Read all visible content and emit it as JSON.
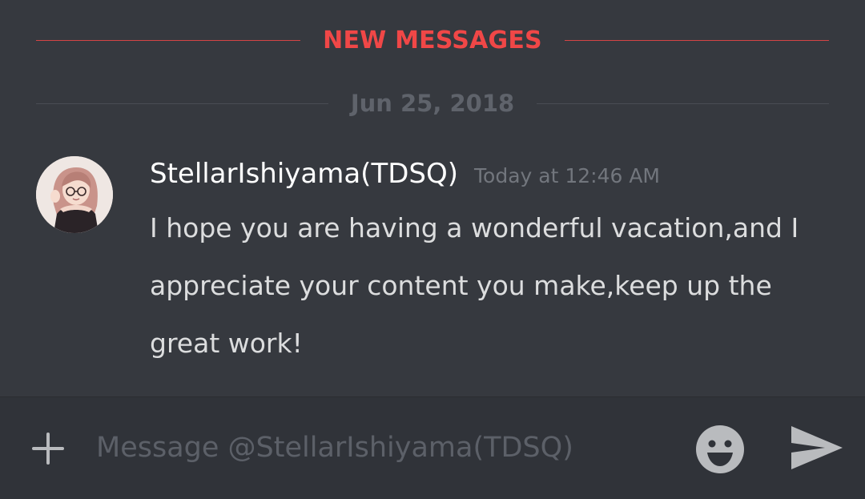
{
  "dividers": {
    "new_messages": "NEW MESSAGES",
    "date": "Jun 25, 2018"
  },
  "message": {
    "username": "StellarIshiyama(TDSQ)",
    "timestamp": "Today at 12:46 AM",
    "text": "I hope you are having a wonderful vacation,and I appreciate your content you make,keep up the great work!"
  },
  "composer": {
    "placeholder": "Message @StellarIshiyama(TDSQ)",
    "value": ""
  },
  "icons": {
    "add": "plus-icon",
    "emoji": "smiley-face-icon",
    "send": "send-arrow-icon"
  },
  "colors": {
    "background": "#36393f",
    "new_messages_accent": "#f04747",
    "username": "#ffffff",
    "message_text": "#dcddde",
    "timestamp": "#72767d",
    "composer_background": "#303339"
  }
}
